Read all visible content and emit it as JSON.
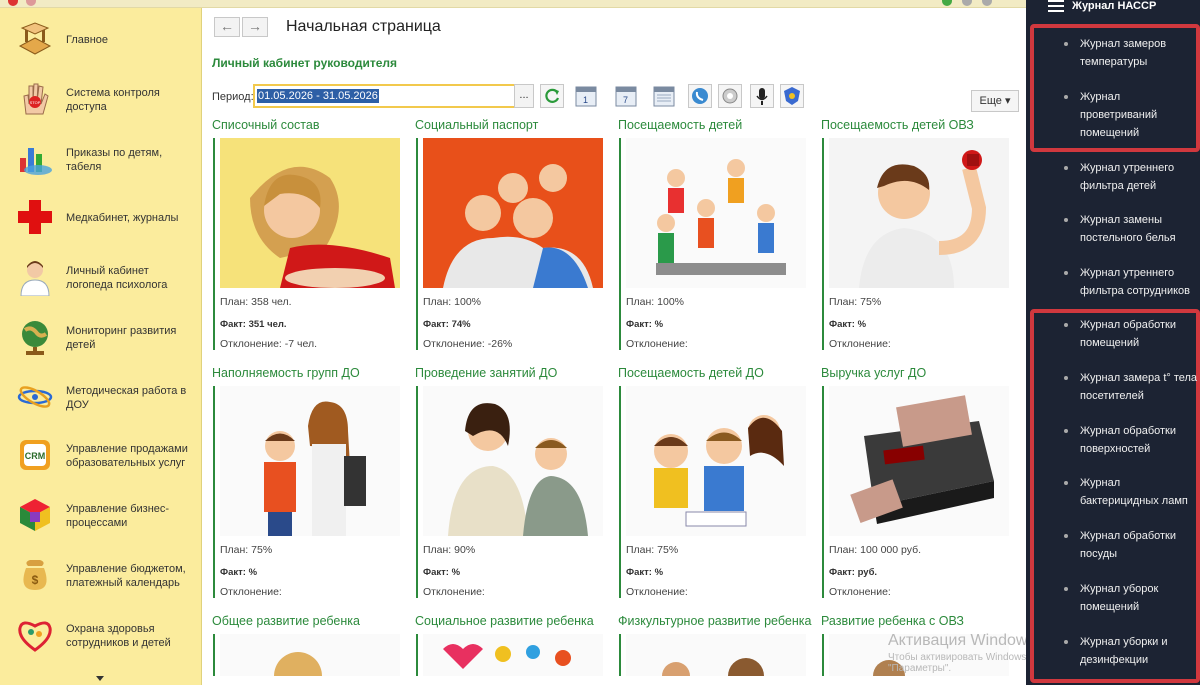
{
  "sidebar": {
    "items": [
      {
        "label": "Главное",
        "icon": "table-icon"
      },
      {
        "label": "Система контроля доступа",
        "icon": "stop-hand-icon"
      },
      {
        "label": "Приказы по детям, табеля",
        "icon": "chart-icon"
      },
      {
        "label": "Медкабинет, журналы",
        "icon": "red-cross-icon"
      },
      {
        "label": "Личный кабинет логопеда психолога",
        "icon": "doctor-icon"
      },
      {
        "label": "Мониторинг развития детей",
        "icon": "globe-icon"
      },
      {
        "label": "Методическая работа в ДОУ",
        "icon": "orbit-icon"
      },
      {
        "label": "Управление продажами образовательных услуг",
        "icon": "crm-icon"
      },
      {
        "label": "Управление бизнес-процессами",
        "icon": "cube-icon"
      },
      {
        "label": "Управление бюджетом, платежный календарь",
        "icon": "money-bag-icon"
      },
      {
        "label": "Охрана здоровья сотрудников и детей",
        "icon": "heart-family-icon"
      }
    ]
  },
  "header": {
    "page_title": "Начальная страница",
    "back": "←",
    "forward": "→"
  },
  "main": {
    "section_title": "Личный кабинет руководителя",
    "period_label": "Период:",
    "period_value": "01.05.2026 - 31.05.2026",
    "period_select": "...",
    "more_button": "Еще",
    "calendar_day": "1",
    "calendar_week": "7"
  },
  "cards": [
    {
      "title": "Списочный состав",
      "plan": "План: 358 чел.",
      "fact": "Факт: 351 чел.",
      "deviation": "Отклонение: -7 чел.",
      "image": "girl"
    },
    {
      "title": "Социальный паспорт",
      "plan": "План: 100%",
      "fact": "Факт: 74%",
      "deviation": "Отклонение: -26%",
      "image": "family"
    },
    {
      "title": "Посещаемость детей",
      "plan": "План: 100%",
      "fact": "Факт: %",
      "deviation": "Отклонение:",
      "image": "kids-group"
    },
    {
      "title": "Посещаемость детей ОВЗ",
      "plan": "План: 75%",
      "fact": "Факт: %",
      "deviation": "Отклонение:",
      "image": "boy-dumbbell"
    },
    {
      "title": "Наполняемость групп ДО",
      "plan": "План: 75%",
      "fact": "Факт: %",
      "deviation": "Отклонение:",
      "image": "school-kids"
    },
    {
      "title": "Проведение занятий ДО",
      "plan": "План: 90%",
      "fact": "Факт: %",
      "deviation": "Отклонение:",
      "image": "teacher"
    },
    {
      "title": "Посещаемость детей ДО",
      "plan": "План: 75%",
      "fact": "Факт: %",
      "deviation": "Отклонение:",
      "image": "reading-kids"
    },
    {
      "title": "Выручка услуг ДО",
      "plan": "План: 100 000 руб.",
      "fact": "Факт: руб.",
      "deviation": "Отклонение:",
      "image": "cash-counter"
    },
    {
      "title": "Общее развитие ребенка",
      "image": "child-a"
    },
    {
      "title": "Социальное развитие ребенка",
      "image": "hands"
    },
    {
      "title": "Физкультурное развитие ребенка",
      "image": "child-b"
    },
    {
      "title": "Развитие ребенка с ОВЗ",
      "image": "child-c"
    }
  ],
  "watermark": {
    "title": "Активация Windows",
    "line1": "Чтобы активировать Windows",
    "line2": "\"Параметры\"."
  },
  "right_panel": {
    "title": "Журнал НАССР",
    "items": [
      "Журнал замеров температуры",
      "Журнал проветриваний помещений",
      "Журнал утреннего фильтра детей",
      "Журнал замены постельного белья",
      "Журнал утреннего фильтра сотрудников",
      "Журнал обработки помещений",
      "Журнал замера t° тела посетителей",
      "Журнал обработки поверхностей",
      "Журнал бактерицидных ламп",
      "Журнал обработки посуды",
      "Журнал уборок помещений",
      "Журнал уборки и дезинфекции"
    ]
  },
  "colors": {
    "sidebar_bg": "#fbec9d",
    "accent_green": "#2c8a3c",
    "right_panel_bg": "#1c2333",
    "highlight_red": "#d0383e",
    "period_border": "#f2c94c"
  }
}
